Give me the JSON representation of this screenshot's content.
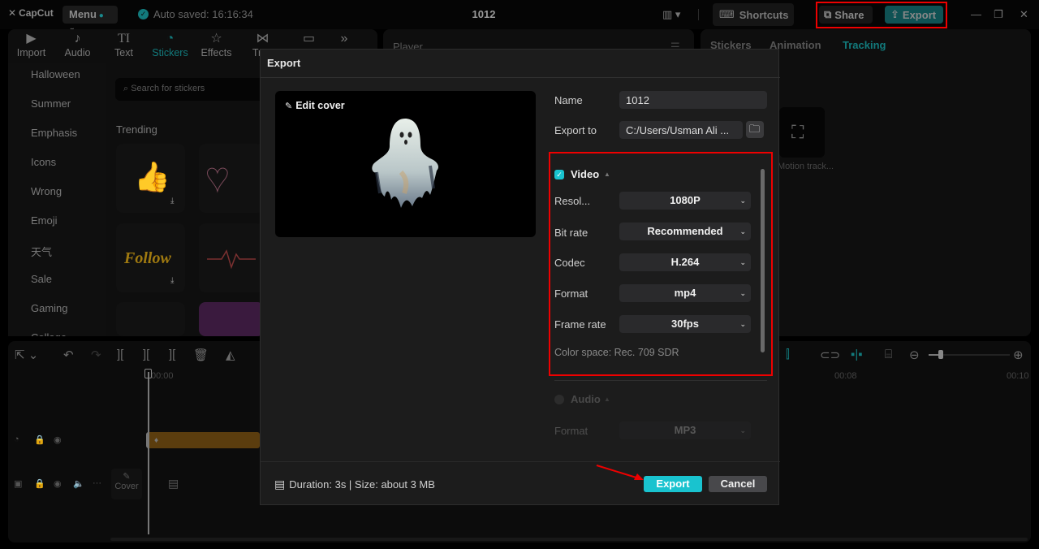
{
  "app": {
    "logo": "CapCut",
    "menu_label": "Menu",
    "autosave": "Auto saved: 16:16:34",
    "project_title": "1012",
    "shortcuts_label": "Shortcuts",
    "share_label": "Share",
    "export_label": "Export"
  },
  "toolbar": {
    "tools": [
      {
        "label": "Import",
        "icon": "import-icon"
      },
      {
        "label": "Audio",
        "icon": "audio-icon"
      },
      {
        "label": "Text",
        "icon": "text-icon"
      },
      {
        "label": "Stickers",
        "icon": "sticker-icon",
        "active": true
      },
      {
        "label": "Effects",
        "icon": "effects-icon"
      },
      {
        "label": "Tran",
        "icon": "transitions-icon"
      },
      {
        "label": "",
        "icon": "captions-icon"
      }
    ]
  },
  "stickers": {
    "categories": [
      "Halloween",
      "Summer",
      "Emphasis",
      "Icons",
      "Wrong",
      "Emoji",
      "天气",
      "Sale",
      "Gaming",
      "Collage"
    ],
    "search_placeholder": "Search for stickers",
    "section_title": "Trending",
    "follow_text": "Follow"
  },
  "player": {
    "title": "Player"
  },
  "right_panel": {
    "tabs": [
      "Stickers",
      "Animation",
      "Tracking"
    ],
    "active_tab": "Tracking",
    "motion_label": "Motion track..."
  },
  "timeline": {
    "ruler": [
      "00:00",
      "00:08",
      "00:10"
    ],
    "cover_label": "Cover"
  },
  "export_dialog": {
    "title": "Export",
    "edit_cover": "Edit cover",
    "name_label": "Name",
    "name_value": "1012",
    "export_to_label": "Export to",
    "export_to_value": "C:/Users/Usman Ali ...",
    "video": {
      "label": "Video",
      "checked": true,
      "settings": [
        {
          "label": "Resol...",
          "value": "1080P"
        },
        {
          "label": "Bit rate",
          "value": "Recommended"
        },
        {
          "label": "Codec",
          "value": "H.264"
        },
        {
          "label": "Format",
          "value": "mp4"
        },
        {
          "label": "Frame rate",
          "value": "30fps"
        }
      ],
      "color_space": "Color space: Rec. 709 SDR"
    },
    "audio": {
      "label": "Audio",
      "checked": false,
      "format_label": "Format",
      "format_value": "MP3"
    },
    "footer_info": "Duration: 3s | Size: about 3 MB",
    "export_button": "Export",
    "cancel_button": "Cancel"
  },
  "colors": {
    "accent": "#19c3cf",
    "highlight_box": "#e00000",
    "dialog_bg": "#1c1c1c"
  }
}
